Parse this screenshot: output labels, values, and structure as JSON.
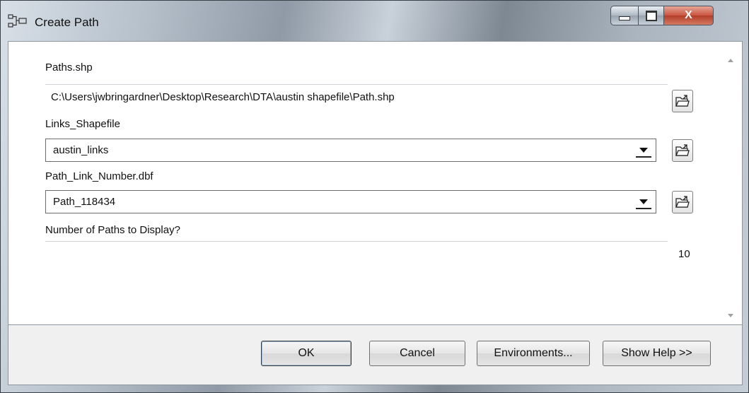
{
  "window": {
    "title": "Create Path",
    "caption_buttons": {
      "minimize": "minimize",
      "maximize": "maximize",
      "close": "X"
    }
  },
  "form": {
    "paths_label": "Paths.shp",
    "paths_value": "C:\\Users\\jwbringardner\\Desktop\\Research\\DTA\\austin shapefile\\Path.shp",
    "links_label": "Links_Shapefile",
    "links_value": "austin_links",
    "pathlink_label": "Path_Link_Number.dbf",
    "pathlink_value": "Path_118434",
    "num_paths_label": "Number of Paths to Display?",
    "num_paths_value": "10"
  },
  "buttons": {
    "ok": "OK",
    "cancel": "Cancel",
    "environments": "Environments...",
    "show_help": "Show Help >>"
  },
  "icons": {
    "app": "tool-icon",
    "browse": "open-folder-icon",
    "dropdown": "chevron-down-icon"
  },
  "colors": {
    "close_button": "#c8553f",
    "client_bg": "#ffffff",
    "footer_bg": "#f0f0f0"
  }
}
